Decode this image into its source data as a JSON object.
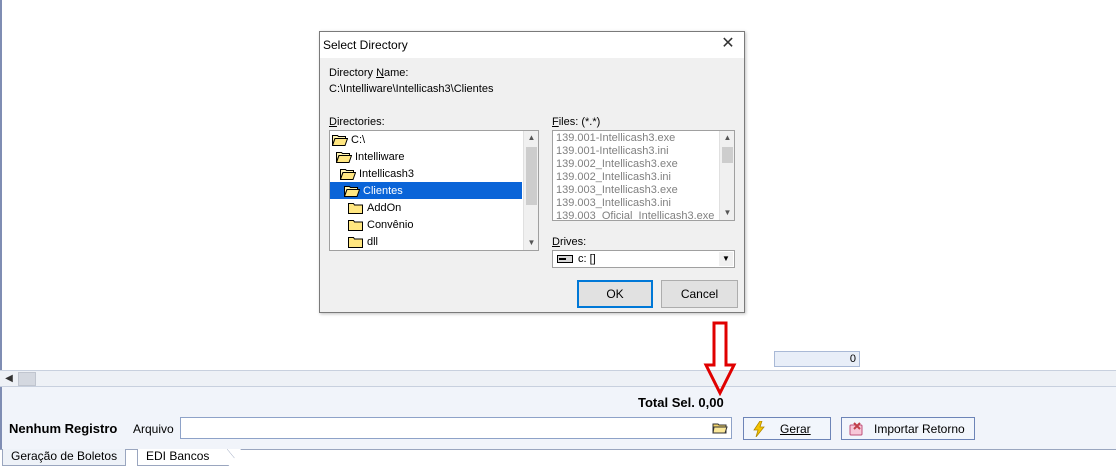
{
  "main": {
    "count_value": "0"
  },
  "footer": {
    "total_sel": "Total Sel. 0,00",
    "status": "Nenhum Registro",
    "arquivo_label": "Arquivo",
    "arquivo_value": "",
    "gerar_label": "Gerar",
    "importar_label": "Importar Retorno"
  },
  "tabs": [
    {
      "label": "Geração de Boletos"
    },
    {
      "label": "EDI Bancos"
    }
  ],
  "dialog": {
    "title": "Select Directory",
    "close_glyph": "✕",
    "dir_name_label": "Directory Name:",
    "dir_path": "C:\\Intelliware\\Intellicash3\\Clientes",
    "directories_label": "Directories:",
    "directories": [
      {
        "name": "C:\\"
      },
      {
        "name": "Intelliware"
      },
      {
        "name": "Intellicash3"
      },
      {
        "name": "Clientes"
      },
      {
        "name": "AddOn"
      },
      {
        "name": "Convênio"
      },
      {
        "name": "dll"
      }
    ],
    "files_label": "Files: (*.*)",
    "files": [
      "139.001-Intellicash3.exe",
      "139.001-Intellicash3.ini",
      "139.002_Intellicash3.exe",
      "139.002_Intellicash3.ini",
      "139.003_Intellicash3.exe",
      "139.003_Intellicash3.ini",
      "139.003_Oficial_Intellicash3.exe"
    ],
    "drives_label": "Drives:",
    "drive_value": "c: []",
    "ok_label": "OK",
    "cancel_label": "Cancel"
  },
  "colors": {
    "selection": "#0a64d8",
    "red_arrow": "#e00000",
    "panel_border": "#7f8db3"
  },
  "icons": [
    "folder-open-icon",
    "folder-closed-icon",
    "drive-icon",
    "browse-folder-icon",
    "lightning-icon",
    "import-icon",
    "red-arrow-down-icon"
  ]
}
